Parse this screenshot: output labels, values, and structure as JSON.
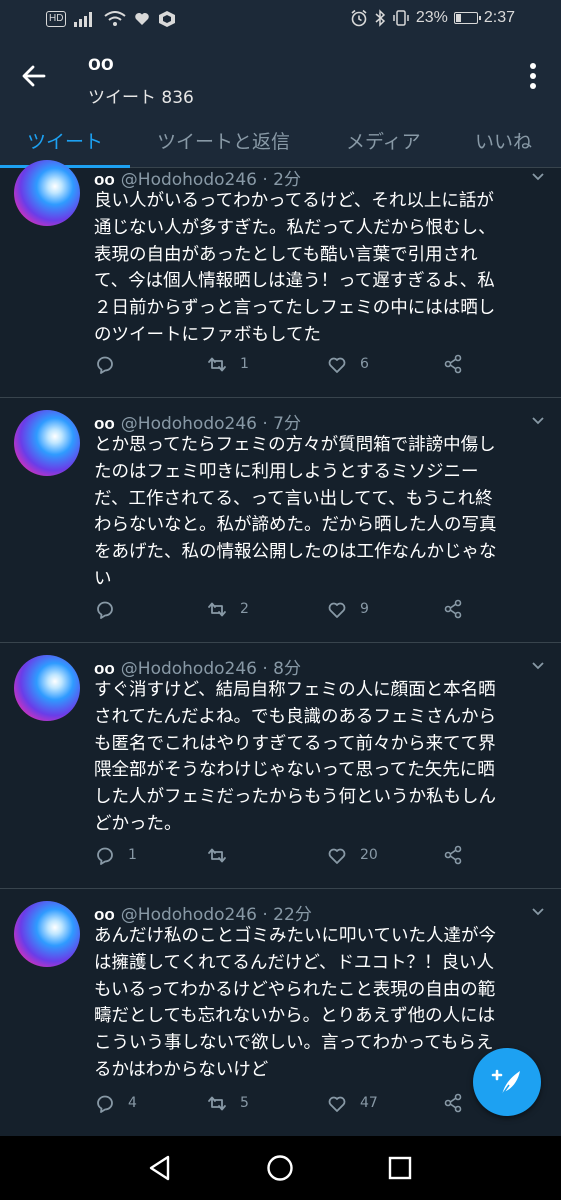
{
  "status_bar": {
    "hd_label": "HD",
    "battery_percent": "23%",
    "battery_level": 0.23,
    "time": "2:37"
  },
  "header": {
    "title": "oo",
    "subtitle": "ツイート 836",
    "back_icon": "arrow-left-icon",
    "more_icon": "more-vertical-icon"
  },
  "tabs": [
    {
      "label": "ツイート",
      "active": true
    },
    {
      "label": "ツイートと返信",
      "active": false
    },
    {
      "label": "メディア",
      "active": false
    },
    {
      "label": "いいね",
      "active": false
    }
  ],
  "tweets": [
    {
      "name": "oo",
      "meta": "@Hodohodo246 · 2分",
      "lines": [
        "良い人がいるってわかってるけど、それ以上に話が",
        "通じない人が多すぎた。私だって人だから恨むし、",
        "表現の自由があったとしても酷い言葉で引用され",
        "て、今は個人情報晒しは違う！って遅すぎるよ、私",
        "２日前からずっと言ってたしフェミの中にはは晒し",
        "のツイートにファボもしてた"
      ],
      "replies": "",
      "retweets": "1",
      "likes": "6"
    },
    {
      "name": "oo",
      "meta": "@Hodohodo246 · 7分",
      "lines": [
        "とか思ってたらフェミの方々が質問箱で誹謗中傷し",
        "たのはフェミ叩きに利用しようとするミソジニー",
        "だ、工作されてる、って言い出してて、もうこれ終",
        "わらないなと。私が諦めた。だから晒した人の写真",
        "をあげた、私の情報公開したのは工作なんかじゃな",
        "い"
      ],
      "replies": "",
      "retweets": "2",
      "likes": "9"
    },
    {
      "name": "oo",
      "meta": "@Hodohodo246 · 8分",
      "lines": [
        "すぐ消すけど、結局自称フェミの人に顔面と本名晒",
        "されてたんだよね。でも良識のあるフェミさんから",
        "も匿名でこれはやりすぎてるって前々から来てて界",
        "隈全部がそうなわけじゃないって思ってた矢先に晒",
        "した人がフェミだったからもう何というか私もしん",
        "どかった。"
      ],
      "replies": "1",
      "retweets": "",
      "likes": "20"
    },
    {
      "name": "oo",
      "meta": "@Hodohodo246 · 22分",
      "lines": [
        "あんだけ私のことゴミみたいに叩いていた人達が今",
        "は擁護してくれてるんだけど、ドユコト？！良い人",
        "もいるってわかるけどやられたこと表現の自由の範",
        "疇だとしても忘れないから。とりあえず他の人には",
        "こういう事しないで欲しい。言ってわかってもらえ",
        "るかはわからないけど"
      ],
      "replies": "4",
      "retweets": "5",
      "likes": "47"
    }
  ],
  "fab": {
    "icon": "compose-tweet-icon"
  },
  "nav": {
    "icons": [
      "back-triangle-icon",
      "home-circle-icon",
      "recents-square-icon"
    ]
  },
  "colors": {
    "background": "#15202b",
    "header": "#1c2938",
    "accent": "#1da1f2",
    "muted": "#8899a6",
    "divider": "#38444d"
  }
}
